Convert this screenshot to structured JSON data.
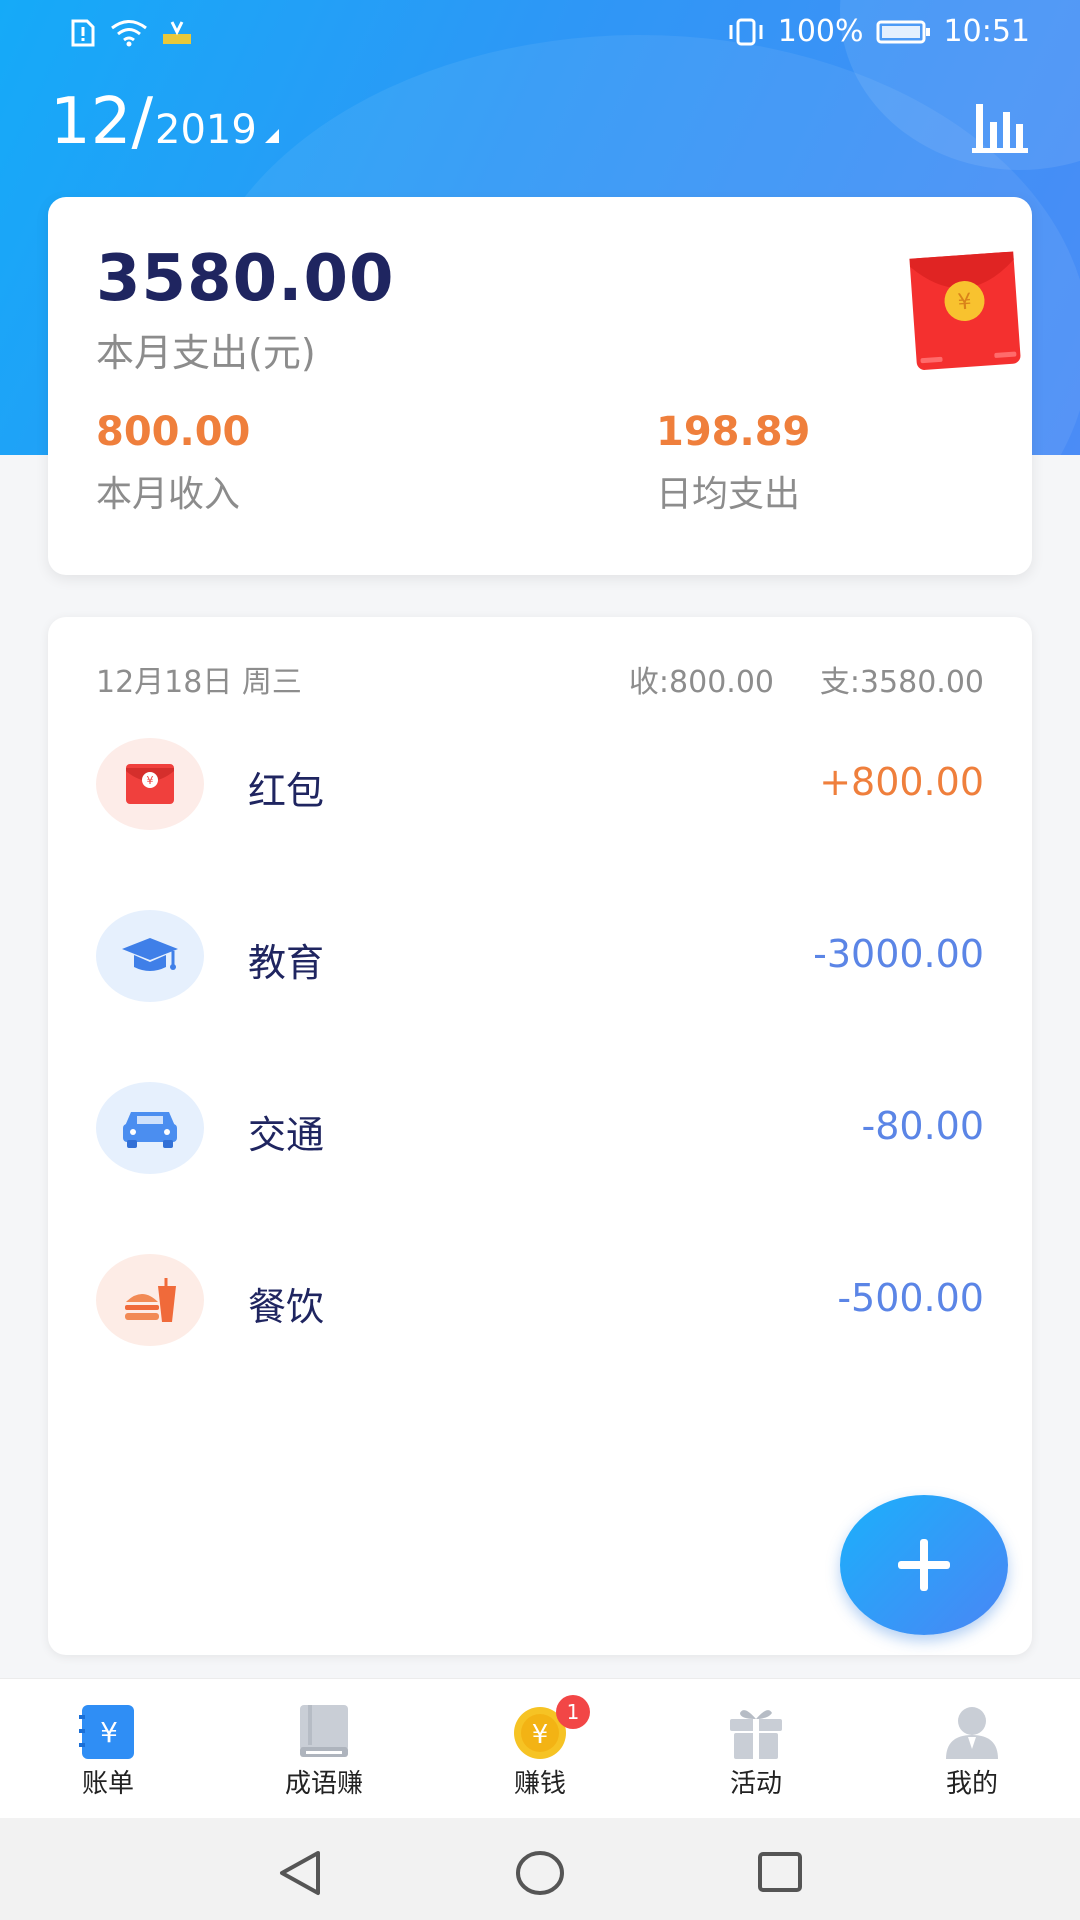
{
  "status_bar": {
    "battery": "100%",
    "time": "10:51"
  },
  "header": {
    "month": "12/",
    "year": "2019"
  },
  "summary": {
    "expense_amount": "3580.00",
    "expense_label": "本月支出(元)",
    "income_amount": "800.00",
    "income_label": "本月收入",
    "daily_avg_amount": "198.89",
    "daily_avg_label": "日均支出"
  },
  "day": {
    "date": "12月18日 周三",
    "income": "收:800.00",
    "expense": "支:3580.00",
    "transactions": [
      {
        "name": "红包",
        "amount": "+800.00",
        "icon": "red-envelope-icon",
        "type": "income"
      },
      {
        "name": "教育",
        "amount": "-3000.00",
        "icon": "graduation-cap-icon",
        "type": "expense"
      },
      {
        "name": "交通",
        "amount": "-80.00",
        "icon": "car-icon",
        "type": "expense"
      },
      {
        "name": "餐饮",
        "amount": "-500.00",
        "icon": "burger-drink-icon",
        "type": "expense"
      }
    ]
  },
  "tabs": [
    {
      "label": "账单",
      "icon": "bill-icon",
      "active": true
    },
    {
      "label": "成语赚",
      "icon": "book-icon"
    },
    {
      "label": "赚钱",
      "icon": "coin-icon",
      "badge": "1"
    },
    {
      "label": "活动",
      "icon": "gift-icon"
    },
    {
      "label": "我的",
      "icon": "user-icon"
    }
  ],
  "colors": {
    "primary": "#2e97f6",
    "income": "#ef7f3c",
    "expense": "#5b85e6",
    "title": "#1f2560"
  }
}
